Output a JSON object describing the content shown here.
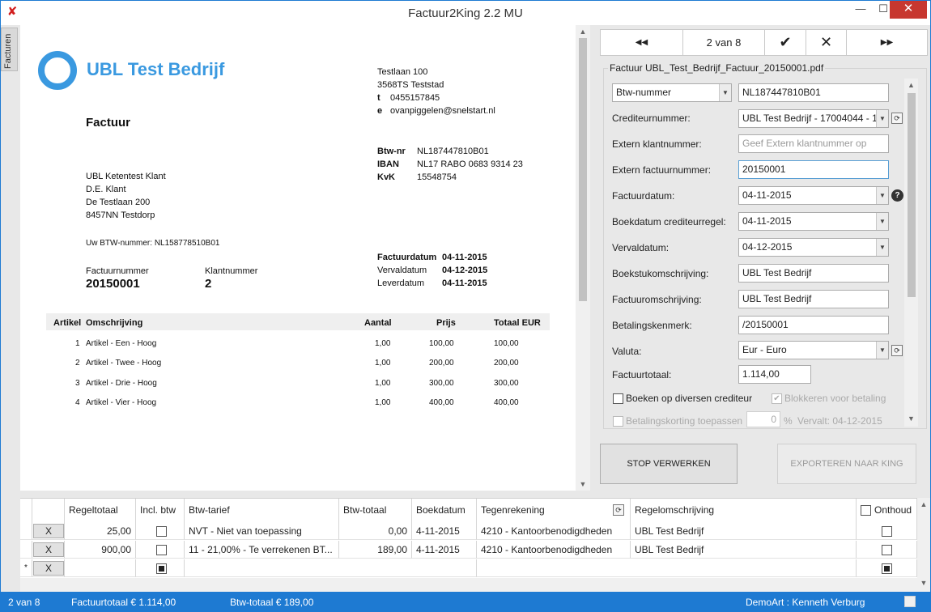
{
  "window": {
    "title": "Factuur2King 2.2 MU",
    "minimize": "—",
    "maximize": "☐",
    "close": "✕",
    "app_icon": "✘"
  },
  "side_tab": "Facturen",
  "document": {
    "company": "UBL Test Bedrijf",
    "sender_address": [
      "Testlaan 100",
      "3568TS  Teststad"
    ],
    "sender_phone_label": "t",
    "sender_phone": "0455157845",
    "sender_email_label": "e",
    "sender_email": "ovanpiggelen@snelstart.nl",
    "heading": "Factuur",
    "btw_label": "Btw-nr",
    "btw_value": "NL187447810B01",
    "iban_label": "IBAN",
    "iban_value": "NL17 RABO 0683 9314 23",
    "kvk_label": "KvK",
    "kvk_value": "15548754",
    "recipient": [
      "UBL Ketentest Klant",
      "D.E. Klant",
      "De Testlaan 200",
      "8457NN  Testdorp"
    ],
    "customer_vat": "Uw BTW-nummer: NL158778510B01",
    "invoice_number_label": "Factuurnummer",
    "invoice_number": "20150001",
    "customer_number_label": "Klantnummer",
    "customer_number": "2",
    "invoice_date_label": "Factuurdatum",
    "invoice_date": "04-11-2015",
    "due_date_label": "Vervaldatum",
    "due_date": "04-12-2015",
    "delivery_date_label": "Leverdatum",
    "delivery_date": "04-11-2015",
    "items_headers": {
      "artikel": "Artikel",
      "omschrijving": "Omschrijving",
      "aantal": "Aantal",
      "prijs": "Prijs",
      "totaal": "Totaal  EUR"
    },
    "items": [
      {
        "nr": "1",
        "desc": "Artikel - Een - Hoog",
        "qty": "1,00",
        "price": "100,00",
        "total": "100,00"
      },
      {
        "nr": "2",
        "desc": "Artikel - Twee - Hoog",
        "qty": "1,00",
        "price": "200,00",
        "total": "200,00"
      },
      {
        "nr": "3",
        "desc": "Artikel - Drie - Hoog",
        "qty": "1,00",
        "price": "300,00",
        "total": "300,00"
      },
      {
        "nr": "4",
        "desc": "Artikel - Vier - Hoog",
        "qty": "1,00",
        "price": "400,00",
        "total": "400,00"
      }
    ]
  },
  "nav": {
    "first": "◀◀",
    "page": "2 van 8",
    "accept": "✔",
    "reject": "✕",
    "last": "▶▶"
  },
  "form": {
    "legend": "Factuur UBL_Test_Bedrijf_Factuur_20150001.pdf",
    "lookup_type": "Btw-nummer",
    "lookup_value": "NL187447810B01",
    "crediteurnummer_label": "Crediteurnummer:",
    "crediteurnummer": "UBL Test Bedrijf - 17004044 - 1",
    "extern_klant_label": "Extern klantnummer:",
    "extern_klant_placeholder": "Geef Extern klantnummer op",
    "extern_factuur_label": "Extern factuurnummer:",
    "extern_factuur": "20150001",
    "factuurdatum_label": "Factuurdatum:",
    "factuurdatum": "04-11-2015",
    "boekdatum_label": "Boekdatum crediteurregel:",
    "boekdatum": "04-11-2015",
    "vervaldatum_label": "Vervaldatum:",
    "vervaldatum": "04-12-2015",
    "boekstuk_label": "Boekstukomschrijving:",
    "boekstuk": "UBL Test Bedrijf",
    "factuuromschr_label": "Factuuromschrijving:",
    "factuuromschr": "UBL Test Bedrijf",
    "betalingskenmerk_label": "Betalingskenmerk:",
    "betalingskenmerk": "/20150001",
    "valuta_label": "Valuta:",
    "valuta": "Eur - Euro",
    "factuurtotaal_label": "Factuurtotaal:",
    "factuurtotaal": "1.114,00",
    "diversen_label": "Boeken op diversen crediteur",
    "blokkeren_label": "Blokkeren voor betaling",
    "blokkeren_mark": "✔",
    "korting_label": "Betalingskorting toepassen",
    "korting_value": "0",
    "korting_unit": "%",
    "korting_vervalt": "Vervalt: 04-12-2015",
    "help": "?",
    "refresh": "⟳"
  },
  "buttons": {
    "stop": "STOP VERWERKEN",
    "export": "EXPORTEREN NAAR KING"
  },
  "grid": {
    "headers": {
      "regeltotaal": "Regeltotaal",
      "incl": "Incl. btw",
      "tarief": "Btw-tarief",
      "btwtotaal": "Btw-totaal",
      "boekdatum": "Boekdatum",
      "tegenrekening": "Tegenrekening",
      "omschrijving": "Regelomschrijving",
      "onthoud": "Onthoud"
    },
    "rows": [
      {
        "del": "X",
        "regeltotaal": "25,00",
        "tarief": "NVT - Niet van toepassing",
        "btwtotaal": "0,00",
        "boekdatum": "4-11-2015",
        "tegenrekening": "4210 - Kantoorbenodigdheden",
        "omschrijving": "UBL Test Bedrijf"
      },
      {
        "del": "X",
        "regeltotaal": "900,00",
        "tarief": "11 - 21,00% - Te verrekenen BT...",
        "btwtotaal": "189,00",
        "boekdatum": "4-11-2015",
        "tegenrekening": "4210 - Kantoorbenodigdheden",
        "omschrijving": "UBL Test Bedrijf"
      }
    ],
    "new_row": {
      "marker": "*",
      "del": "X"
    }
  },
  "status": {
    "page": "2 van 8",
    "factuurtotaal": "Factuurtotaal  € 1.114,00",
    "btwtotaal": "Btw-totaal  € 189,00",
    "user": "DemoArt  :  Kenneth Verburg"
  }
}
